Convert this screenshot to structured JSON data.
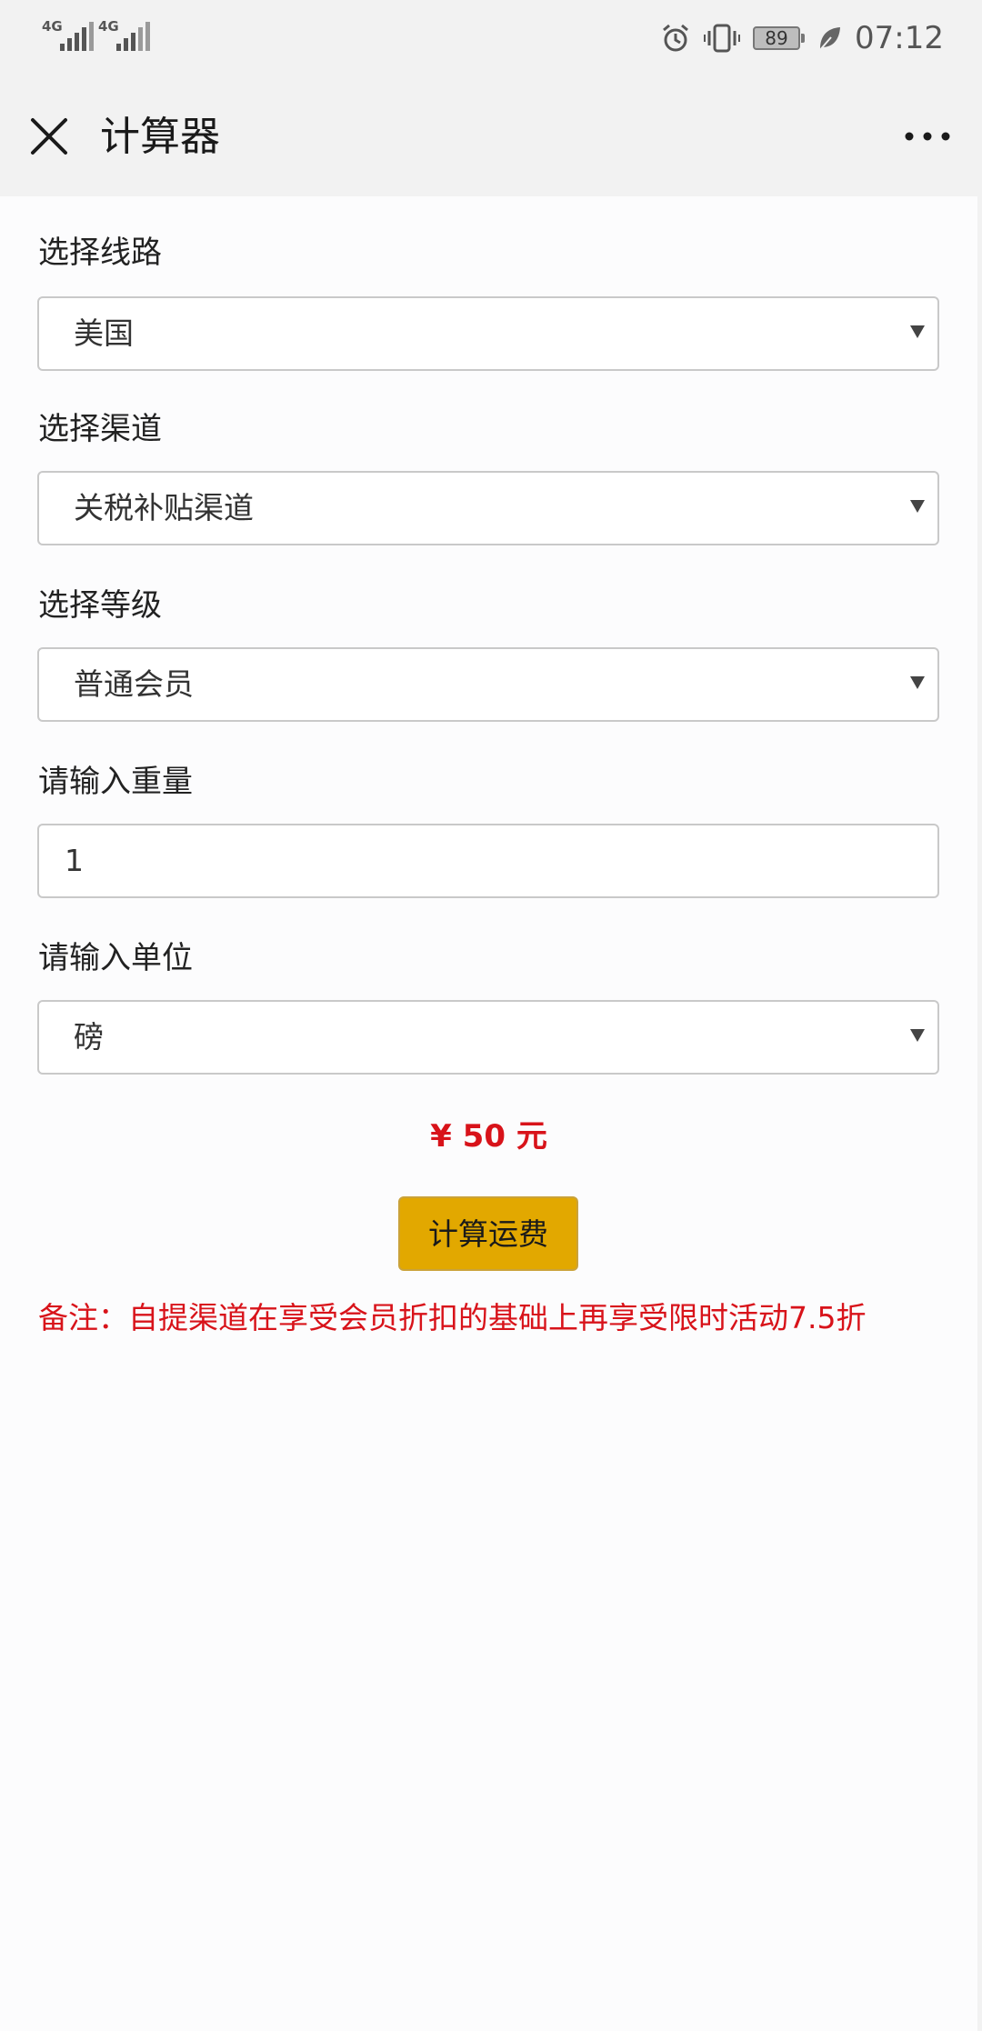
{
  "status_bar": {
    "network_1": "4G",
    "network_2": "4G",
    "battery": "89",
    "time": "07:12"
  },
  "header": {
    "title": "计算器",
    "close_icon": "close-icon",
    "more_icon": "more-icon"
  },
  "form": {
    "route": {
      "label": "选择线路",
      "selected": "美国"
    },
    "channel": {
      "label": "选择渠道",
      "selected": "关税补贴渠道"
    },
    "level": {
      "label": "选择等级",
      "selected": "普通会员"
    },
    "weight": {
      "label": "请输入重量",
      "value": "1"
    },
    "unit": {
      "label": "请输入单位",
      "selected": "磅"
    }
  },
  "result": {
    "price": "¥ 50 元"
  },
  "actions": {
    "calculate_label": "计算运费"
  },
  "note": "备注：自提渠道在享受会员折扣的基础上再享受限时活动7.5折",
  "colors": {
    "accent_red": "#d8131a",
    "button_gold": "#e2a800"
  }
}
